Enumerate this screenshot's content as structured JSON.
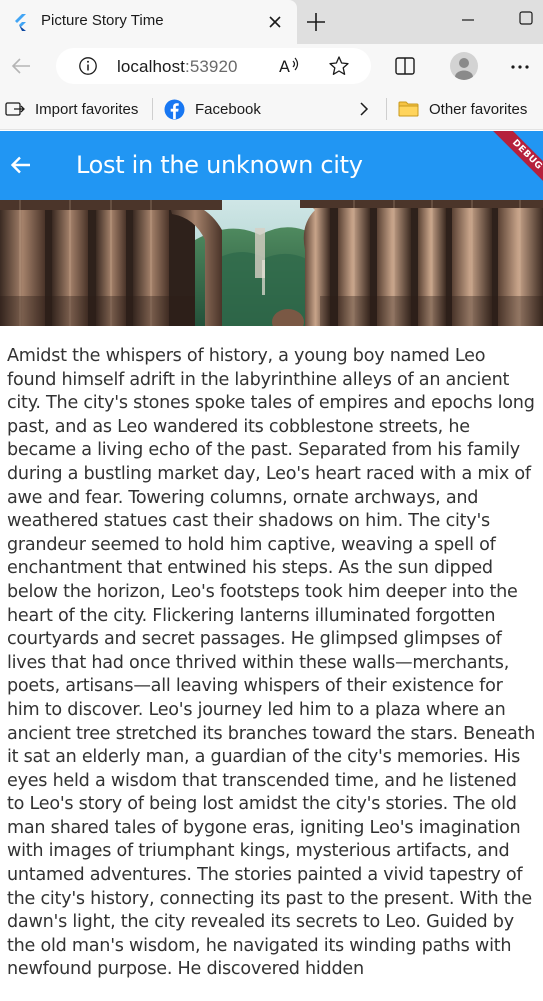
{
  "browser": {
    "tab_title": "Picture Story Time",
    "url_host": "localhost",
    "url_port": ":53920",
    "favorites": {
      "import_label": "Import favorites",
      "facebook_label": "Facebook",
      "other_label": "Other favorites"
    },
    "accent_color": "#0078d4"
  },
  "app": {
    "title": "Lost in the unknown city",
    "debug_label": "DEBUG",
    "appbar_color": "#2196f3",
    "story_text": "Amidst the whispers of history, a young boy named Leo found himself adrift in the labyrinthine alleys of an ancient city. The city's stones spoke tales of empires and epochs long past, and as Leo wandered its cobblestone streets, he became a living echo of the past. Separated from his family during a bustling market day, Leo's heart raced with a mix of awe and fear. Towering columns, ornate archways, and weathered statues cast their shadows on him. The city's grandeur seemed to hold him captive, weaving a spell of enchantment that entwined his steps. As the sun dipped below the horizon, Leo's footsteps took him deeper into the heart of the city. Flickering lanterns illuminated forgotten courtyards and secret passages. He glimpsed glimpses of lives that had once thrived within these walls—merchants, poets, artisans—all leaving whispers of their existence for him to discover. Leo's journey led him to a plaza where an ancient tree stretched its branches toward the stars. Beneath it sat an elderly man, a guardian of the city's memories. His eyes held a wisdom that transcended time, and he listened to Leo's story of being lost amidst the city's stories. The old man shared tales of bygone eras, igniting Leo's imagination with images of triumphant kings, mysterious artifacts, and untamed adventures. The stories painted a vivid tapestry of the city's history, connecting its past to the present. With the dawn's light, the city revealed its secrets to Leo. Guided by the old man's wisdom, he navigated its winding paths with newfound purpose. He discovered hidden"
  }
}
